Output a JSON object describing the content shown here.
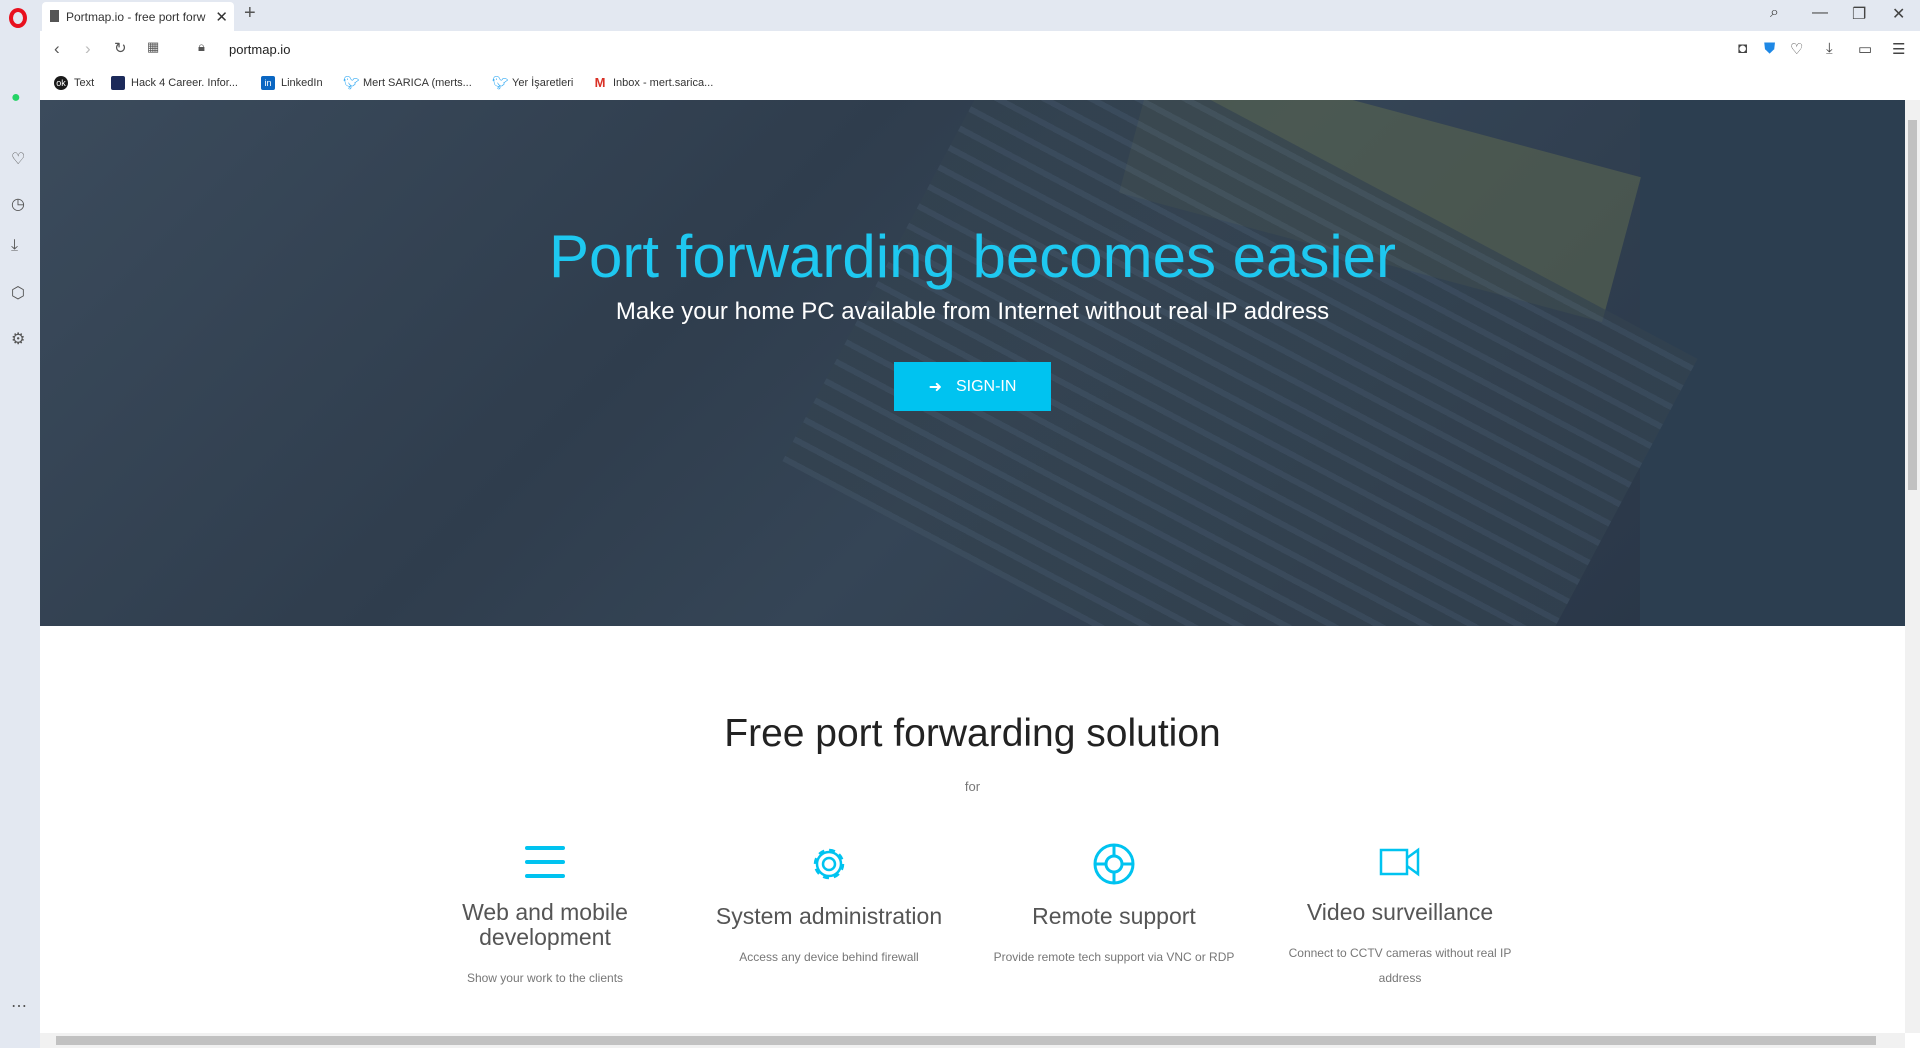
{
  "browser": {
    "tab_title": "Portmap.io - free port forw",
    "url": "portmap.io",
    "bookmarks": [
      {
        "label": "Text",
        "icon": "ok-icon",
        "color": "#1a1a1a"
      },
      {
        "label": "Hack 4 Career. Infor...",
        "icon": "hack4career-icon",
        "color": "#1c2a5a"
      },
      {
        "label": "LinkedIn",
        "icon": "linkedin-icon",
        "color": "#0a66c2"
      },
      {
        "label": "Mert SARICA (merts...",
        "icon": "twitter-icon",
        "color": "#1da1f2"
      },
      {
        "label": "Yer İşaretleri",
        "icon": "twitter-icon",
        "color": "#1da1f2"
      },
      {
        "label": "Inbox - mert.sarica...",
        "icon": "gmail-icon",
        "color": "#d93025"
      }
    ]
  },
  "hero": {
    "title": "Port forwarding becomes easier",
    "subtitle": "Make your home PC available from Internet without real IP address",
    "signin_label": "SIGN-IN",
    "accent": "#00c3f0"
  },
  "solutions": {
    "title": "Free port forwarding solution",
    "for": "for",
    "features": [
      {
        "icon": "menu-icon",
        "title": "Web and mobile development",
        "desc": "Show your work to the clients"
      },
      {
        "icon": "gear-icon",
        "title": "System administration",
        "desc": "Access any device behind firewall"
      },
      {
        "icon": "lifebuoy-icon",
        "title": "Remote support",
        "desc": "Provide remote tech support via VNC or RDP"
      },
      {
        "icon": "video-camera-icon",
        "title": "Video surveillance",
        "desc": "Connect to CCTV cameras without real IP address"
      }
    ]
  }
}
